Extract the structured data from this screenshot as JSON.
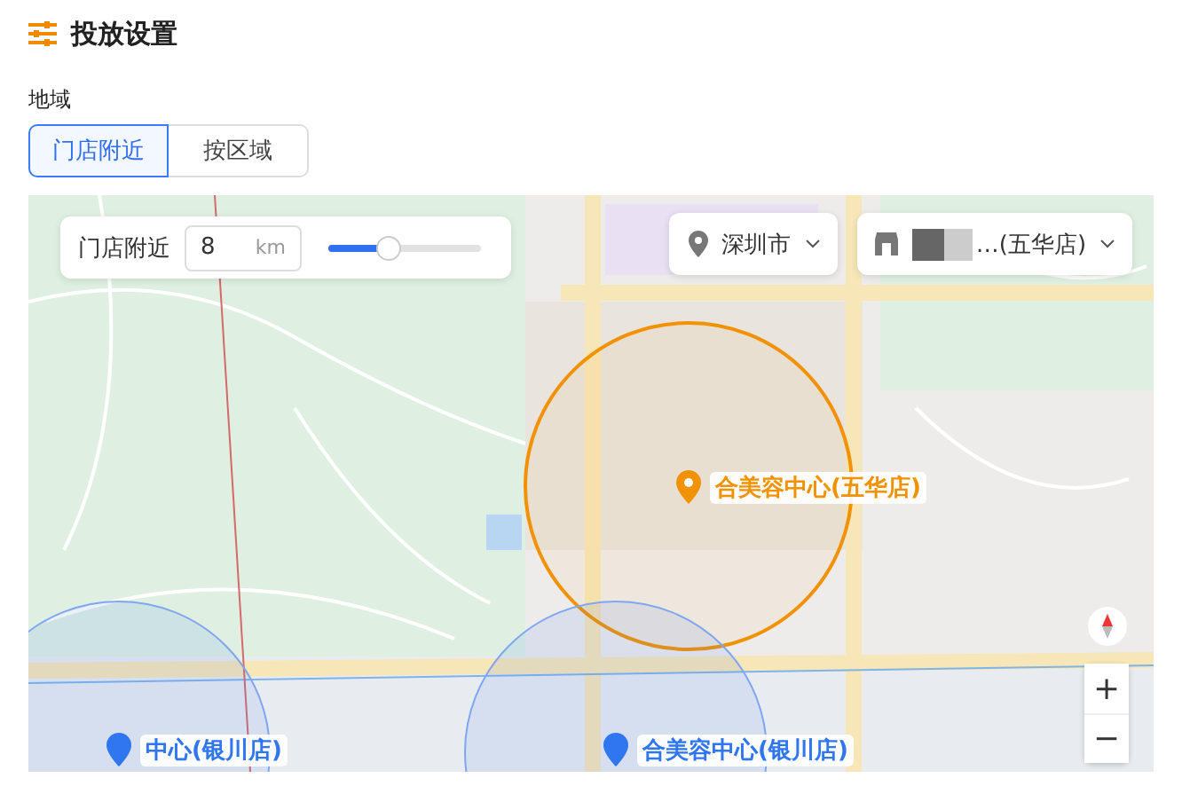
{
  "title": "投放设置",
  "region_label": "地域",
  "tabs": [
    {
      "label": "门店附近",
      "selected": true
    },
    {
      "label": "按区域",
      "selected": false
    }
  ],
  "radius": {
    "label": "门店附近",
    "value": "8",
    "unit": "km",
    "level": 0.4
  },
  "city": {
    "value": "深圳市"
  },
  "store": {
    "value": "…(五华店)"
  },
  "map": {
    "markers": [
      {
        "label": "合美容中心(五华店)",
        "kind": "selected"
      },
      {
        "label": "中心(银川店)",
        "kind": "other"
      },
      {
        "label": "合美容中心(银川店)",
        "kind": "other"
      }
    ],
    "zoom_in": "+",
    "zoom_out": "−"
  }
}
